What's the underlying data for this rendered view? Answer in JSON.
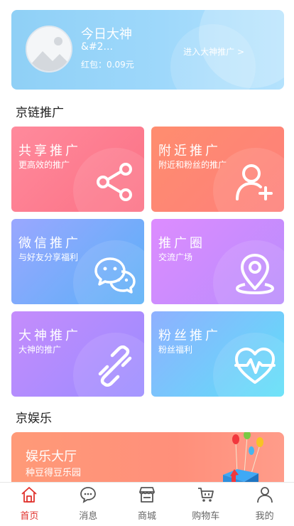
{
  "banner": {
    "title": "今日大神",
    "nickname": "&#2...",
    "red_packet": "红包：0.09元",
    "enter_link": "进入大神推广 >"
  },
  "sections": {
    "jd_promo": "京链推广",
    "jd_fun": "京娱乐"
  },
  "cards": [
    {
      "title": "共享推广",
      "subtitle": "更高效的推广",
      "icon": "share-icon"
    },
    {
      "title": "附近推广",
      "subtitle": "附近和粉丝的推广",
      "icon": "add-user-icon"
    },
    {
      "title": "微信推广",
      "subtitle": "与好友分享福利",
      "icon": "wechat-icon"
    },
    {
      "title": "推广圈",
      "subtitle": "交流广场",
      "icon": "location-icon"
    },
    {
      "title": "大神推广",
      "subtitle": "大神的推广",
      "icon": "link-icon"
    },
    {
      "title": "粉丝推广",
      "subtitle": "粉丝福利",
      "icon": "heart-pulse-icon"
    }
  ],
  "entertainment": {
    "title": "娱乐大厅",
    "subtitle": "种豆得豆乐园"
  },
  "tabbar": [
    {
      "label": "首页",
      "icon": "home-icon",
      "active": true
    },
    {
      "label": "消息",
      "icon": "message-icon",
      "active": false
    },
    {
      "label": "商城",
      "icon": "store-icon",
      "active": false
    },
    {
      "label": "购物车",
      "icon": "cart-icon",
      "active": false
    },
    {
      "label": "我的",
      "icon": "profile-icon",
      "active": false
    }
  ],
  "colors": {
    "active_tab": "#e0312c",
    "banner_blue": "#9ed8fb"
  }
}
